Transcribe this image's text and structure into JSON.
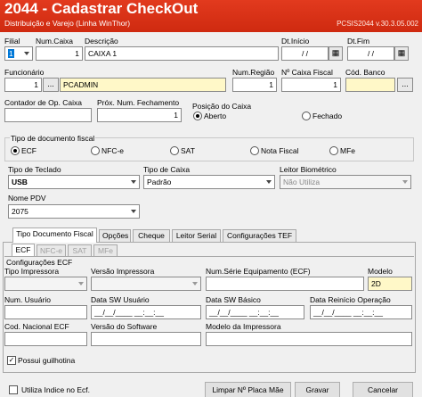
{
  "header": {
    "title": "2044 - Cadastrar CheckOut",
    "subtitle": "Distribuição e Varejo (Linha WinThor)",
    "version": "PCSIS2044  v.30.3.05.002"
  },
  "fields": {
    "filial_label": "Filial",
    "filial_value": "1",
    "num_caixa_label": "Num.Caixa",
    "num_caixa_value": "1",
    "descricao_label": "Descrição",
    "descricao_value": "CAIXA 1",
    "dt_inicio_label": "Dt.Início",
    "dt_inicio_value": "/ /",
    "dt_fim_label": "Dt.Fim",
    "dt_fim_value": "/ /",
    "funcionario_label": "Funcionário",
    "funcionario_code": "1",
    "funcionario_name": "PCADMIN",
    "funcionario_btn": "...",
    "num_regiao_label": "Num.Região",
    "num_regiao_value": "1",
    "caixa_fiscal_label": "Nº Caixa Fiscal",
    "caixa_fiscal_value": "1",
    "cod_banco_label": "Cód. Banco",
    "cod_banco_btn": "...",
    "contador_label": "Contador de Op. Caixa",
    "prox_num_label": "Próx. Num. Fechamento",
    "prox_num_value": "1",
    "posicao_label": "Posição do Caixa",
    "aberto_label": "Aberto",
    "fechado_label": "Fechado"
  },
  "tipo_doc": {
    "label": "Tipo de documento fiscal",
    "options": [
      "ECF",
      "NFC-e",
      "SAT",
      "Nota Fiscal",
      "MFe"
    ],
    "selected": "ECF"
  },
  "selects": {
    "tipo_teclado_label": "Tipo de Teclado",
    "tipo_teclado_value": "USB",
    "tipo_caixa_label": "Tipo de Caixa",
    "tipo_caixa_value": "Padrão",
    "leitor_label": "Leitor Biométrico",
    "leitor_value": "Não Utiliza",
    "nome_pdv_label": "Nome PDV",
    "nome_pdv_value": "2075"
  },
  "tabs": [
    "Tipo Documento Fiscal",
    "Opções",
    "Cheque",
    "Leitor Serial",
    "Configurações TEF"
  ],
  "subtabs": [
    "ECF",
    "NFC-e",
    "SAT",
    "MFe"
  ],
  "ecf": {
    "group_label": "Configurações ECF",
    "tipo_impressora_label": "Tipo Impressora",
    "versao_impressora_label": "Versão Impressora",
    "num_serie_label": "Num.Série Equipamento (ECF)",
    "modelo_label": "Modelo",
    "modelo_value": "2D",
    "num_usuario_label": "Num. Usuário",
    "data_sw_usuario_label": "Data  SW Usuário",
    "data_sw_usuario_value": "__/__/____ __:__:__",
    "data_sw_basico_label": "Data SW Básico",
    "data_sw_basico_value": "__/__/____ __:__:__",
    "data_reinicio_label": "Data Reinício Operação",
    "data_reinicio_value": "__/__/____ __:__:__",
    "cod_nacional_label": "Cod. Nacional ECF",
    "versao_software_label": "Versão do Software",
    "modelo_impressora_label": "Modelo da Impressora",
    "guilhotina_label": "Possui guilhotina"
  },
  "footer": {
    "utiliza_indice_label": "Utiliza Indice no Ecf.",
    "limpar_label": "Limpar Nº Placa Mãe",
    "gravar_label": "Gravar",
    "cancelar_label": "Cancelar"
  }
}
